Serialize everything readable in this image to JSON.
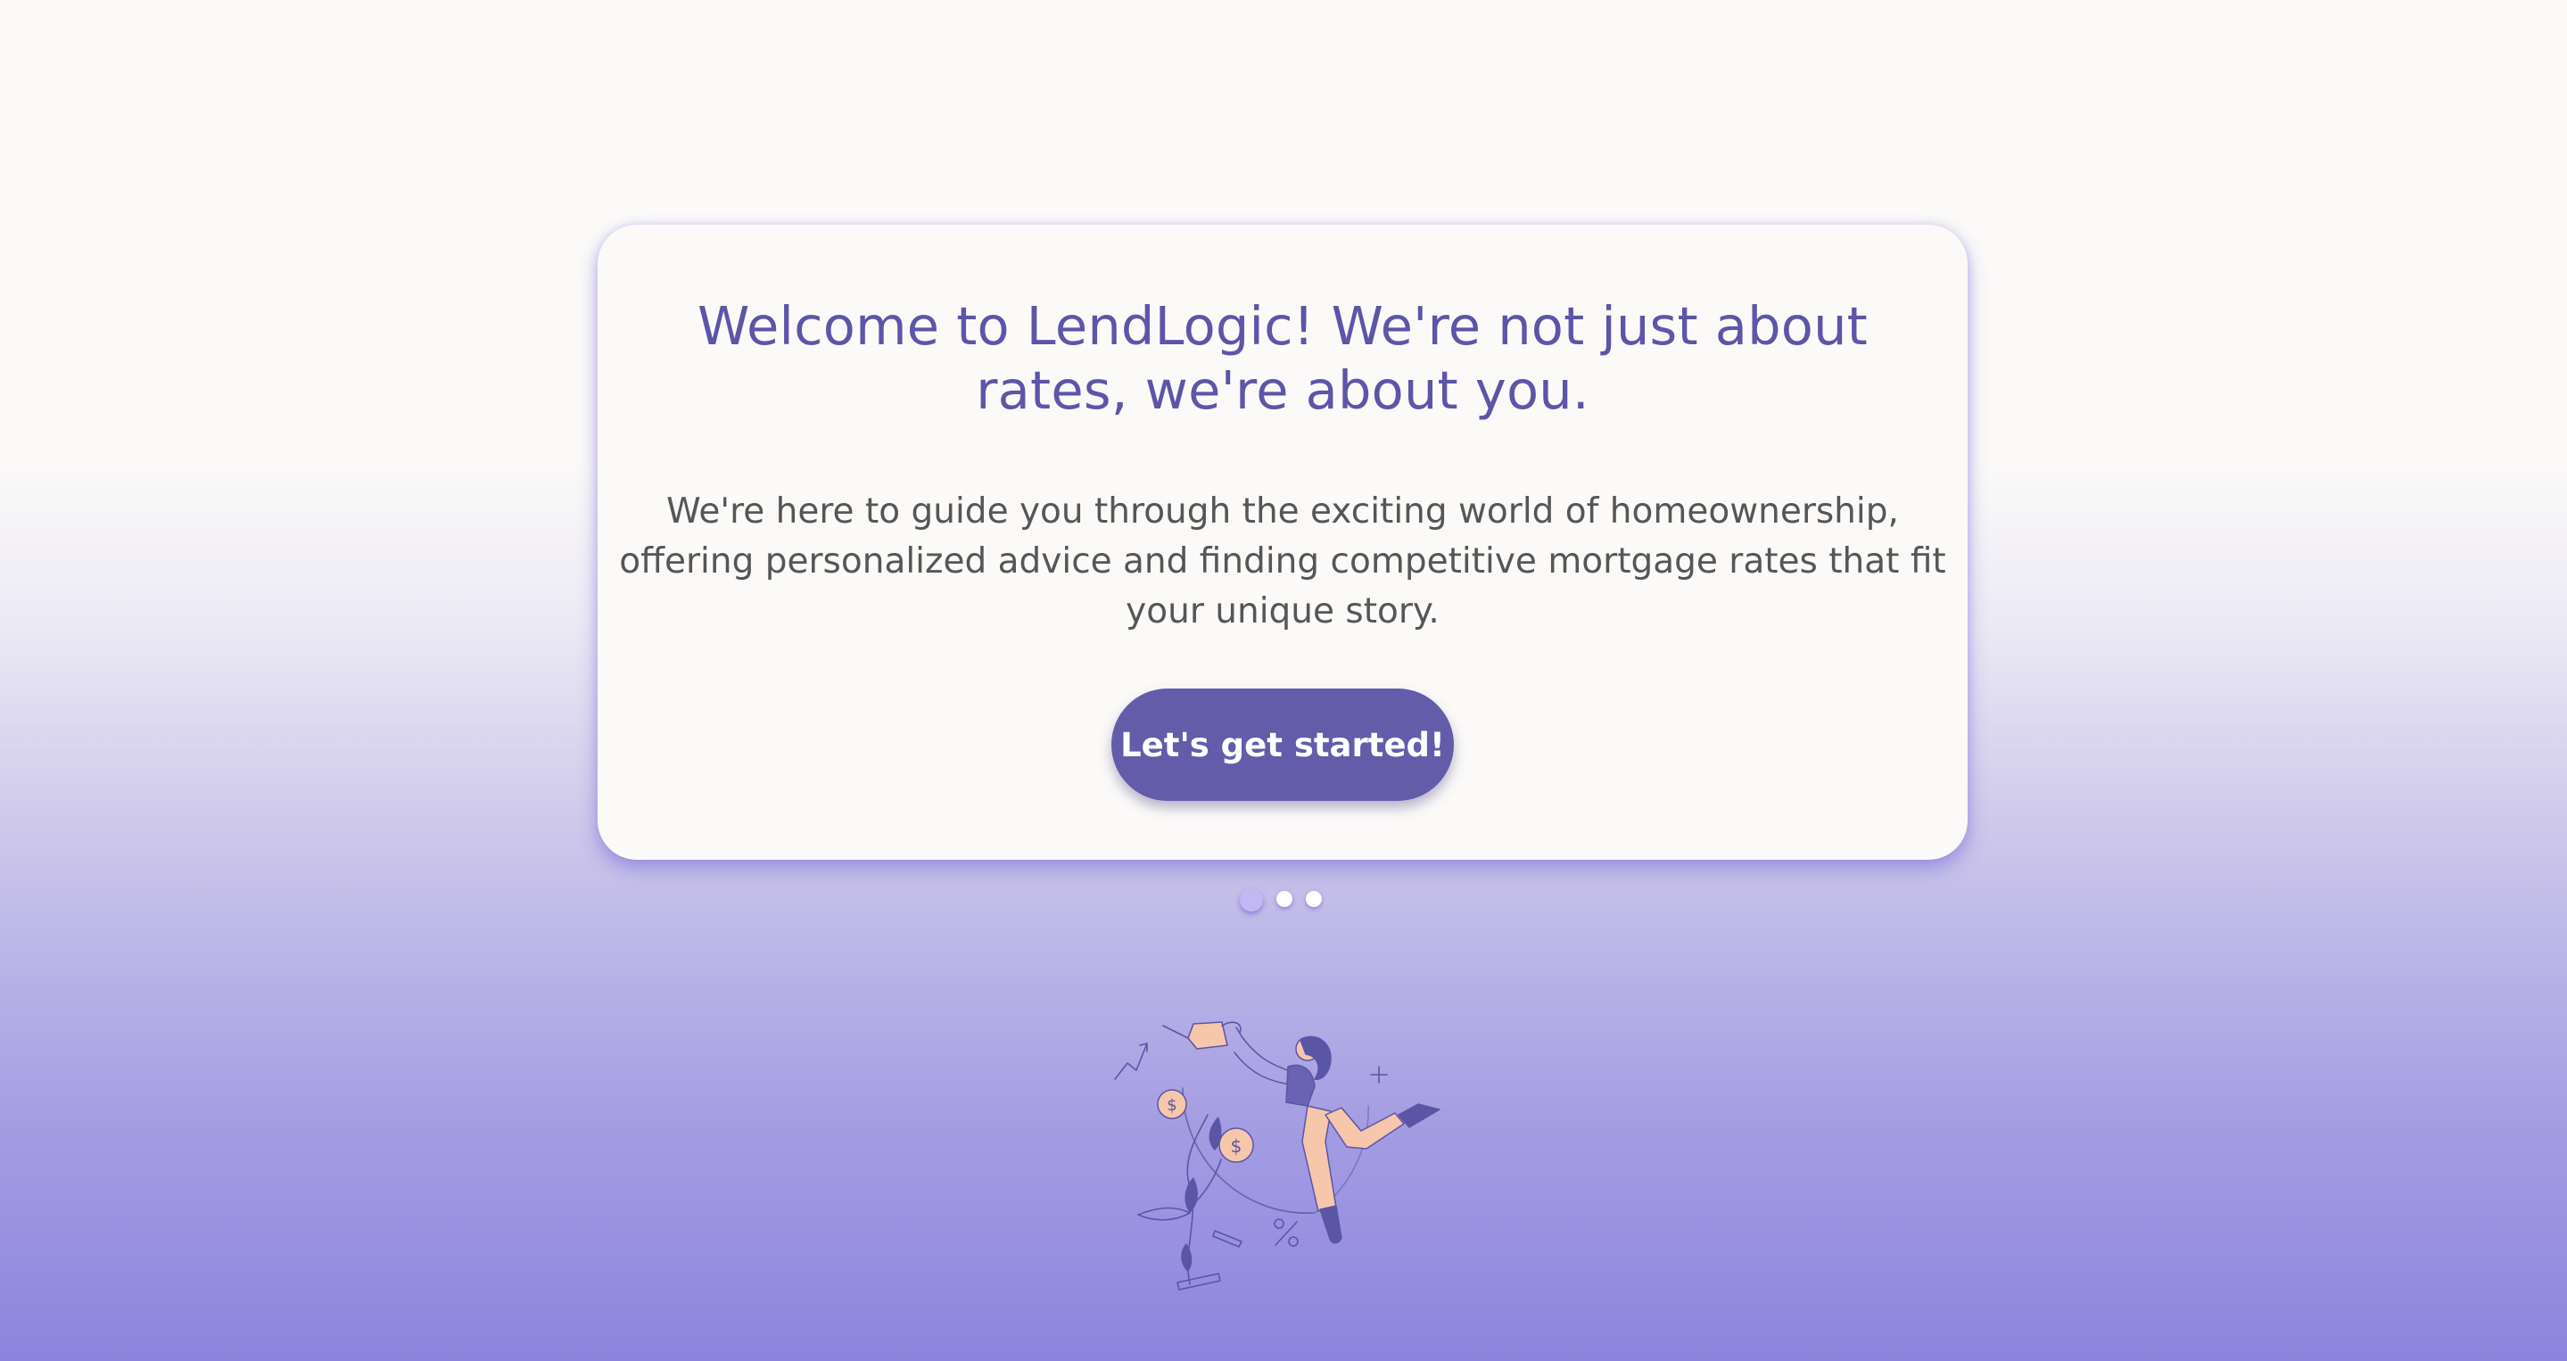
{
  "welcome": {
    "heading": "Welcome to LendLogic! We're not just about rates, we're about you.",
    "body": "We're here to guide you through the exciting world of homeownership, offering personalized advice and finding competitive mortgage rates that fit your unique story.",
    "cta_label": "Let's get started!"
  },
  "carousel": {
    "slide_count": 3,
    "active_index": 0
  },
  "illustration": {
    "icon": "person-watering-money-plant-icon"
  },
  "colors": {
    "accent": "#625ca9",
    "heading": "#5d55a8",
    "body_text": "#565656",
    "card_bg": "#fbfaf8",
    "active_dot": "#c4b8f4",
    "gradient_bottom": "#8c84dd"
  }
}
